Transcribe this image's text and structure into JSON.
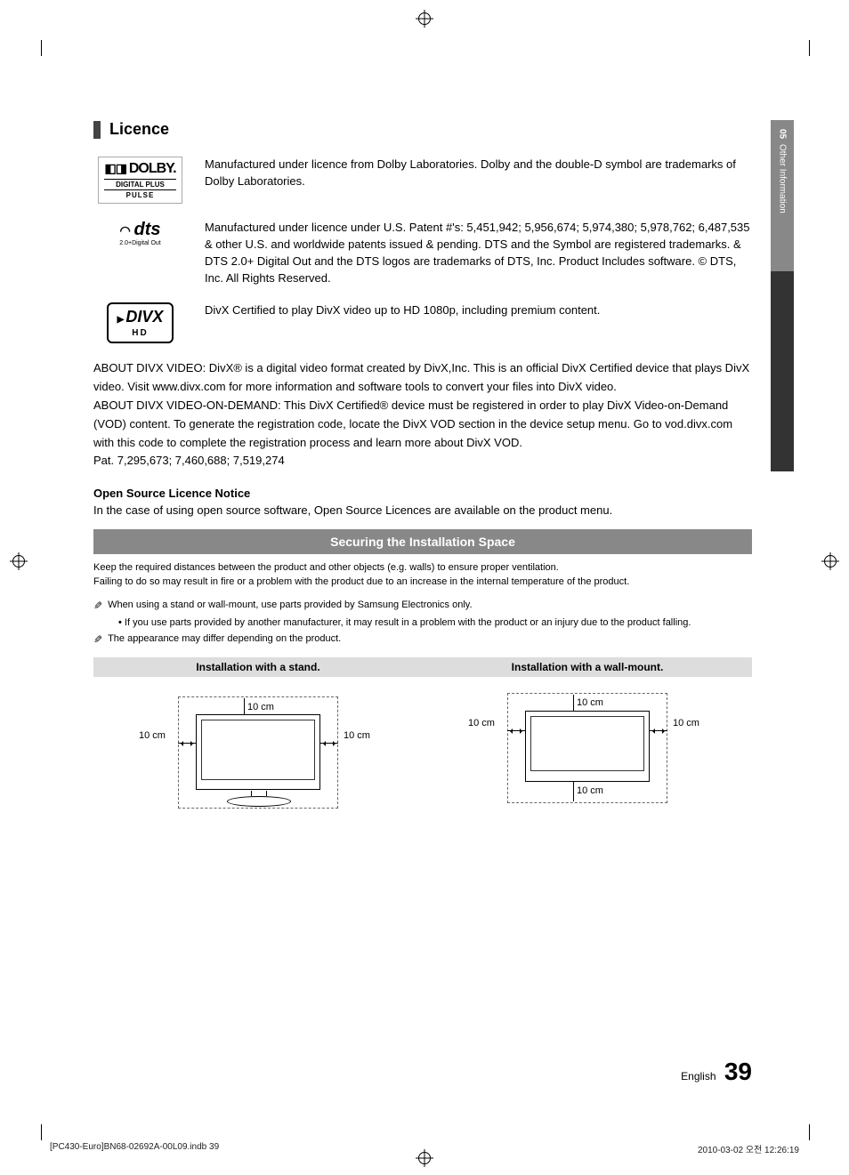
{
  "side_tab": {
    "number": "05",
    "label": "Other Information"
  },
  "licence": {
    "heading": "Licence",
    "dolby": {
      "logo_main": "DOLBY.",
      "logo_sub1": "DIGITAL PLUS",
      "logo_sub2": "PULSE",
      "text": "Manufactured under licence from Dolby Laboratories. Dolby and the double-D symbol are trademarks of Dolby Laboratories."
    },
    "dts": {
      "logo_main": "dts",
      "logo_sub": "2.0+Digital Out",
      "text": "Manufactured under licence under U.S. Patent #'s: 5,451,942; 5,956,674; 5,974,380; 5,978,762; 6,487,535 & other U.S. and worldwide patents issued & pending. DTS and the Symbol are registered trademarks. & DTS 2.0+ Digital Out and the DTS logos are trademarks of DTS, Inc. Product Includes software. © DTS, Inc. All Rights Reserved."
    },
    "divx": {
      "logo_main": "DIVX",
      "logo_sub": "HD",
      "text": "DivX Certified to play DivX video up to HD 1080p, including premium content."
    },
    "about_divx": {
      "p1": "ABOUT DIVX VIDEO: DivX® is a digital video format created by DivX,Inc. This is an official DivX Certified device that plays DivX video. Visit www.divx.com for more information and software tools to convert your files into DivX video.",
      "p2": "ABOUT DIVX VIDEO-ON-DEMAND: This DivX Certified® device must be registered in order to play DivX Video-on-Demand (VOD) content. To generate the registration code, locate the DivX VOD section in the device setup menu. Go to vod.divx.com with this code to complete the registration process and learn more about DivX VOD.",
      "p3": "Pat. 7,295,673; 7,460,688; 7,519,274"
    },
    "open_source": {
      "heading": "Open Source Licence Notice",
      "text": "In the case of using open source software, Open Source Licences are available on the product menu."
    }
  },
  "securing": {
    "banner": "Securing the Installation Space",
    "intro1": "Keep the required distances between the product and other objects (e.g. walls) to ensure proper ventilation.",
    "intro2": "Failing to do so may result in fire or a problem with the product due to an increase in the internal temperature of the product.",
    "note1": "When using a stand or wall-mount, use parts provided by Samsung Electronics only.",
    "bullet1": "If you use parts provided by another manufacturer, it may result in a problem with the product or an injury due to the product falling.",
    "note2": "The appearance may differ depending on the product.",
    "stand": {
      "title": "Installation with a stand.",
      "top": "10 cm",
      "left": "10 cm",
      "right": "10 cm"
    },
    "wall": {
      "title": "Installation with a wall-mount.",
      "top": "10 cm",
      "left": "10 cm",
      "right": "10 cm",
      "bottom": "10 cm"
    }
  },
  "footer": {
    "language": "English",
    "page": "39"
  },
  "imprint": {
    "left": "[PC430-Euro]BN68-02692A-00L09.indb   39",
    "right": "2010-03-02   오전 12:26:19"
  }
}
